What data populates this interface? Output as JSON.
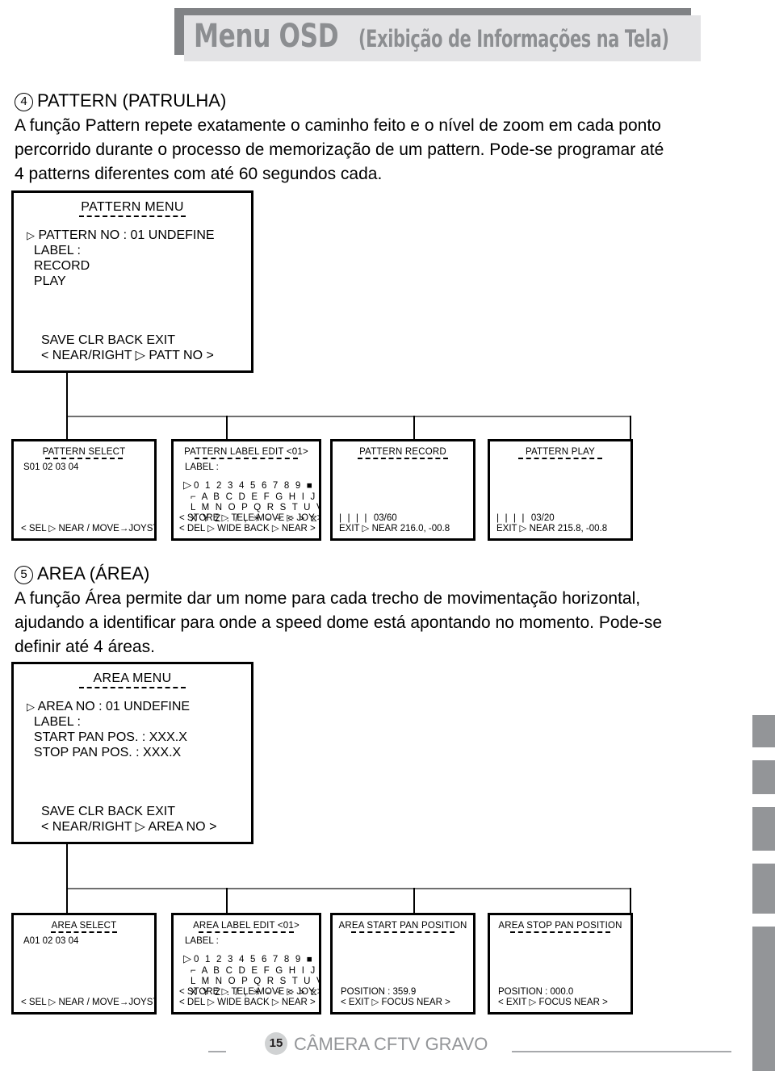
{
  "header": {
    "title_main": "Menu OSD",
    "title_sub": "(Exibição de Informações na Tela)"
  },
  "sections": [
    {
      "number": "4",
      "heading": "PATTERN (PATRULHA)",
      "paragraph_lines": [
        "A função Pattern repete exatamente o caminho feito e o nível de zoom em cada ponto",
        "percorrido durante o processo de memorização de um pattern. Pode-se programar até",
        "4 patterns diferentes com até 60 segundos cada."
      ]
    },
    {
      "number": "5",
      "heading": "AREA (ÁREA)",
      "paragraph_lines": [
        "A função Área permite dar um nome para cada trecho de movimentação horizontal,",
        "ajudando a identificar para onde a speed dome está apontando no momento. Pode-se",
        "definir até 4 áreas."
      ]
    }
  ],
  "pattern_menu": {
    "title": "PATTERN MENU",
    "rows": [
      {
        "cursor": "▷",
        "label": "PATTERN NO : 01 UNDEFINE"
      },
      {
        "cursor": "",
        "label": "LABEL           :"
      },
      {
        "cursor": "",
        "label": "RECORD"
      },
      {
        "cursor": "",
        "label": "PLAY"
      }
    ],
    "footer_line1": "SAVE   CLR   BACK   EXIT",
    "footer_line2": "< NEAR/RIGHT  ▷ PATT NO    >"
  },
  "area_menu": {
    "title": "AREA MENU",
    "rows": [
      {
        "cursor": "▷",
        "label": "AREA NO   : 01 UNDEFINE"
      },
      {
        "cursor": "",
        "label": "LABEL        :"
      },
      {
        "cursor": "",
        "label": "START PAN POS. :  XXX.X"
      },
      {
        "cursor": "",
        "label": "STOP  PAN POS. :  XXX.X"
      }
    ],
    "footer_line1": "SAVE   CLR   BACK   EXIT",
    "footer_line2": "< NEAR/RIGHT  ▷ AREA NO    >"
  },
  "charset_rows": [
    "0 1 2 3 4 5 6 7 8 9 ■",
    "⌐ A B C D E F G H I J K",
    "L M N O P Q R S T U V W",
    "X Y Z . / , ✳ - − < > ⧖"
  ],
  "label_edit_common": {
    "label_field": "LABEL :",
    "cursor": "▷",
    "footer_line1": "< STORE ▷ TELE   MOVE ▷ JOY  >",
    "footer_line2": "< DEL    ▷ WIDE   BACK ▷ NEAR >"
  },
  "pattern_boxes": {
    "select": {
      "title": "PATTERN SELECT",
      "items": "S01   02   03   04",
      "footer": "< SEL ▷ NEAR / MOVE→JOYSTICK >"
    },
    "label_edit": {
      "title": "PATTERN LABEL EDIT <01>"
    },
    "record": {
      "title": "PATTERN RECORD",
      "meter": "| | | |",
      "counter": "03/60",
      "footer": "EXIT ▷  NEAR      216.0, -00.8"
    },
    "play": {
      "title": "PATTERN PLAY",
      "meter": "| | | |",
      "counter": "03/20",
      "footer": "EXIT ▷  NEAR      215.8, -00.8"
    }
  },
  "area_boxes": {
    "select": {
      "title": "AREA SELECT",
      "items": "A01   02   03   04",
      "footer": "< SEL ▷ NEAR / MOVE→JOYSTICK >"
    },
    "label_edit": {
      "title": "AREA LABEL EDIT <01>"
    },
    "start_pan": {
      "title": "AREA START PAN POSITION",
      "position": "POSITION  :  359.9",
      "footer": "<  EXIT  ▷   FOCUS NEAR    >"
    },
    "stop_pan": {
      "title": "AREA STOP PAN POSITION",
      "position": "POSITION  :  000.0",
      "footer": "<  EXIT  ▷   FOCUS NEAR    >"
    }
  },
  "footer": {
    "page_number": "15",
    "text": "CÂMERA CFTV GRAVO"
  }
}
